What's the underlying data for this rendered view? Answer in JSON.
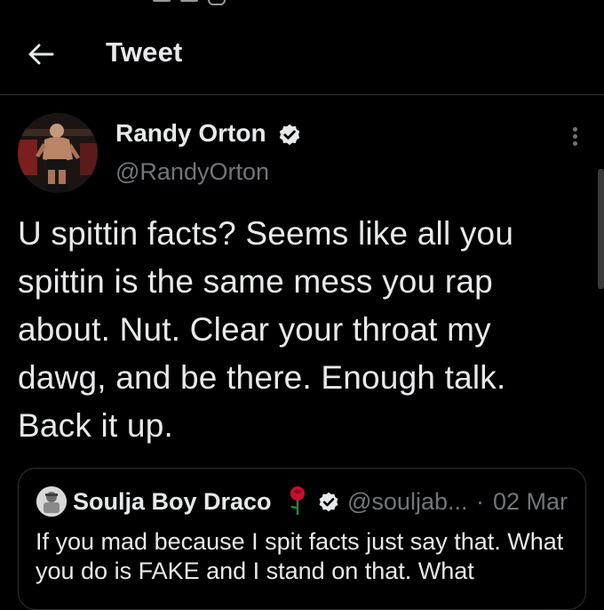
{
  "header": {
    "title": "Tweet"
  },
  "tweet": {
    "author_name": "Randy Orton",
    "author_handle": "@RandyOrton",
    "text": "U spittin facts? Seems like all you spittin is the same mess you rap about. Nut. Clear your throat my dawg, and be there. Enough talk. Back it up."
  },
  "quoted_tweet": {
    "author_name": "Soulja Boy Draco",
    "author_handle": "@souljab...",
    "separator": "·",
    "date": "02 Mar",
    "text": "If you mad because I spit facts just say that. What you do is FAKE and I stand on that. What"
  },
  "colors": {
    "background": "#000000",
    "text_primary": "#e7e9ea",
    "text_secondary": "#71767b",
    "divider": "#2f3336",
    "rose_red": "#c8102e"
  },
  "icons": {
    "back": "arrow-left-icon",
    "more": "more-vertical-icon",
    "verified": "verified-badge-icon",
    "rose": "rose-emoji-icon"
  }
}
